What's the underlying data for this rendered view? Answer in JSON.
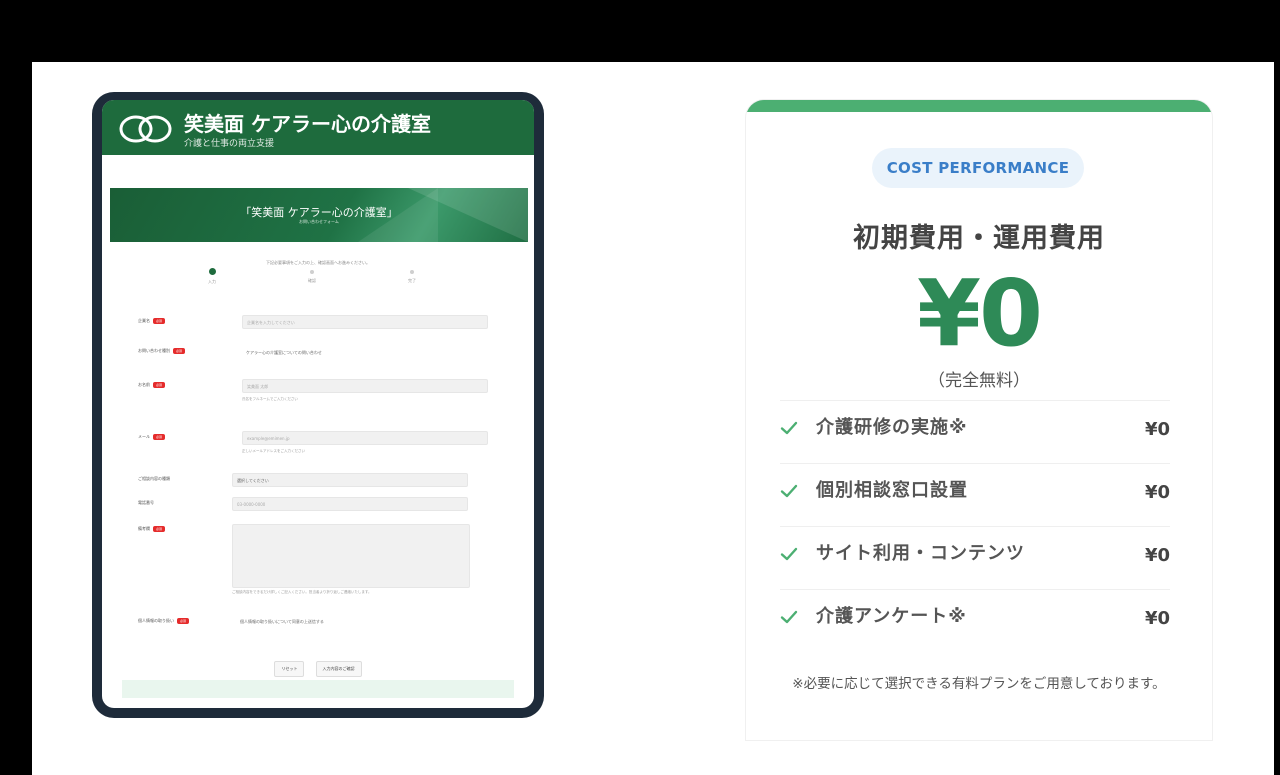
{
  "tablet": {
    "site_title": "笑美面 ケアラー心の介護室",
    "site_subtitle": "介護と仕事の両立支援",
    "banner_title": "「笑美面 ケアラー心の介護室」",
    "banner_subtitle": "お問い合わせフォーム",
    "intro_text": "下記必要事項をご入力の上、確認画面へお進みください。",
    "steps": [
      {
        "label": "入力"
      },
      {
        "label": "確認"
      },
      {
        "label": "完了"
      }
    ],
    "required_badge": "必須",
    "fields": {
      "company": {
        "label": "企業名",
        "placeholder": "企業名を入力してください"
      },
      "inquiry_type": {
        "label": "お問い合わせ種別",
        "value": "ケアラー心の介護室についての問い合わせ"
      },
      "name": {
        "label": "お名前",
        "placeholder": "笑美面 太郎",
        "help": "氏名をフルネームでご入力ください"
      },
      "email": {
        "label": "メール",
        "placeholder": "example@emimen.jp",
        "help": "正しいメールアドレスをご入力ください"
      },
      "category": {
        "label": "ご相談内容の種類",
        "value": "選択してください"
      },
      "phone": {
        "label": "電話番号",
        "placeholder": "03-0000-0000"
      },
      "message": {
        "label": "備考欄",
        "help": "ご相談内容をできるだけ詳しくご記入ください。担当者より折り返しご連絡いたします。"
      },
      "privacy": {
        "label": "個人情報の取り扱い",
        "text": "個人情報の取り扱いについて同意の上送信する"
      }
    },
    "buttons": {
      "reset": "リセット",
      "confirm": "入力内容のご確認"
    }
  },
  "pricing": {
    "badge": "COST PERFORMANCE",
    "heading": "初期費用・運用費用",
    "price": "¥0",
    "price_note": "（完全無料）",
    "items": [
      {
        "label": "介護研修の実施※",
        "value": "¥0"
      },
      {
        "label": "個別相談窓口設置",
        "value": "¥0"
      },
      {
        "label": "サイト利用・コンテンツ",
        "value": "¥0"
      },
      {
        "label": "介護アンケート※",
        "value": "¥0"
      }
    ],
    "footnote": "※必要に応じて選択できる有料プランをご用意しております。",
    "colors": {
      "accent": "#4caf72",
      "price": "#2e8a57",
      "badge_text": "#3a7ec8",
      "check": "#4caf72"
    }
  }
}
